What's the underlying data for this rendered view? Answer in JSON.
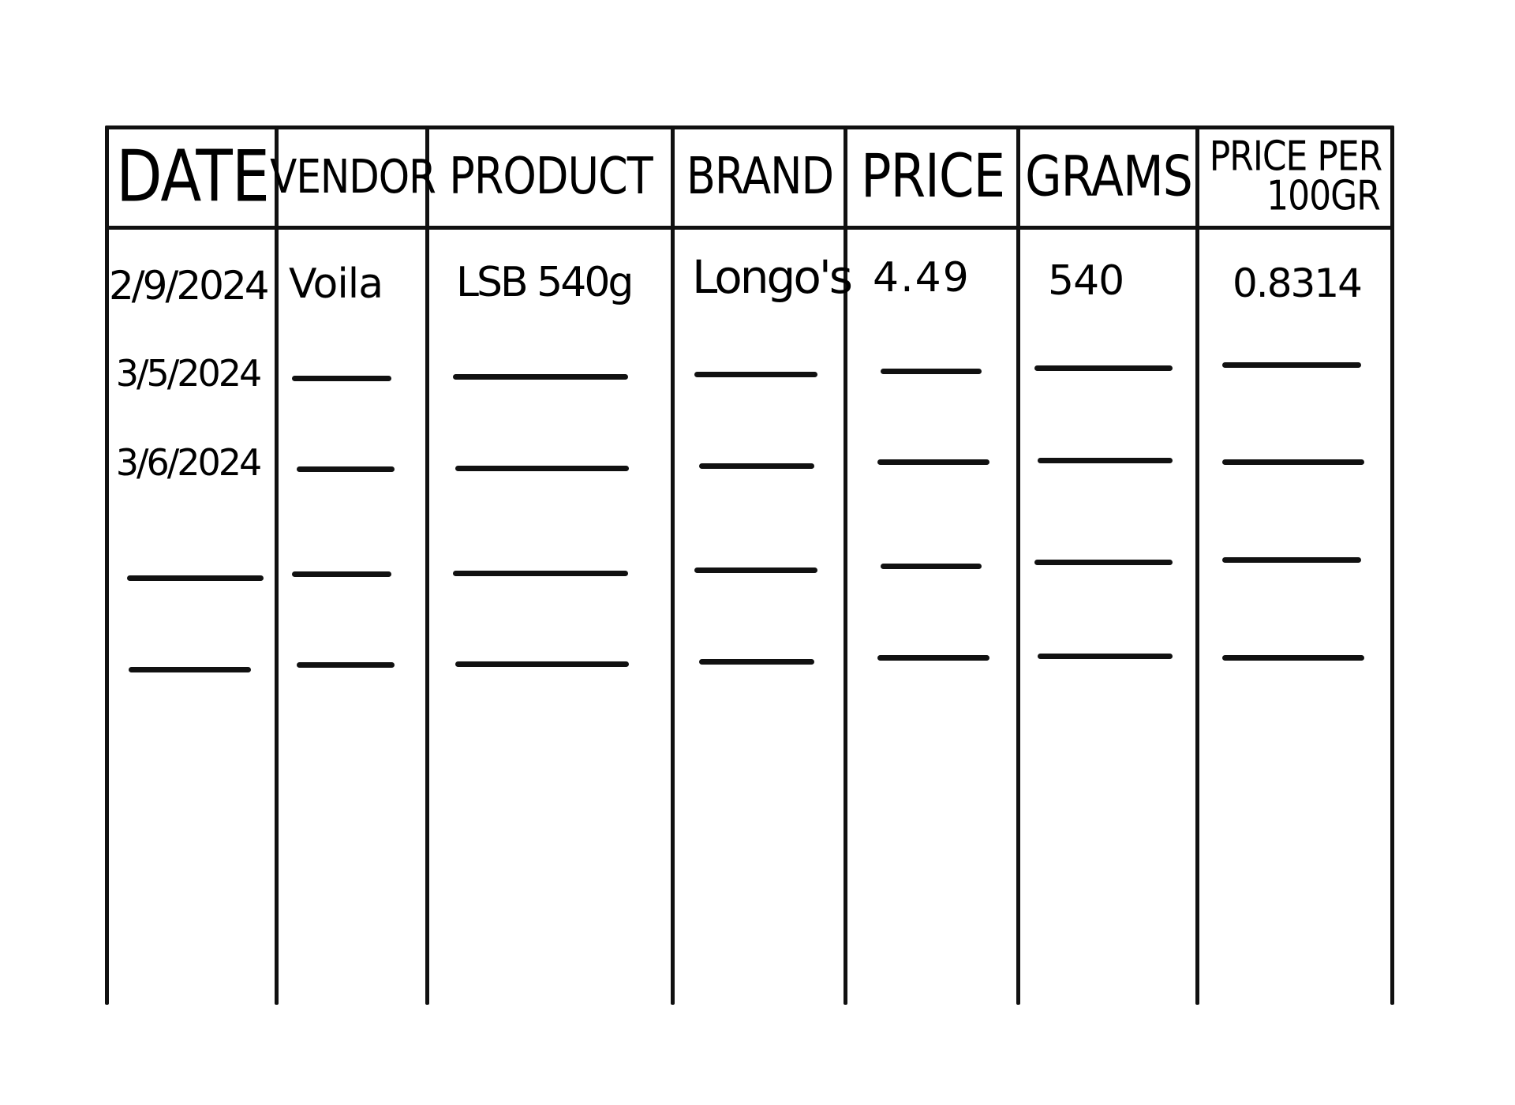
{
  "table": {
    "headers": {
      "date": "DATE",
      "vendor": "VENDOR",
      "product": "PRODUCT",
      "brand": "BRAND",
      "price": "PRICE",
      "grams": "GRAMS",
      "price_per_100gr_line1": "PRICE PER",
      "price_per_100gr_line2": "100GR"
    },
    "rows": [
      {
        "date": "2/9/2024",
        "vendor": "Voila",
        "product": "LSB 540g",
        "brand": "Longo's",
        "price": "4.49",
        "grams": "540",
        "price_per_100gr": "0.8314"
      },
      {
        "date": "3/5/2024"
      },
      {
        "date": "3/6/2024"
      },
      {},
      {}
    ]
  }
}
